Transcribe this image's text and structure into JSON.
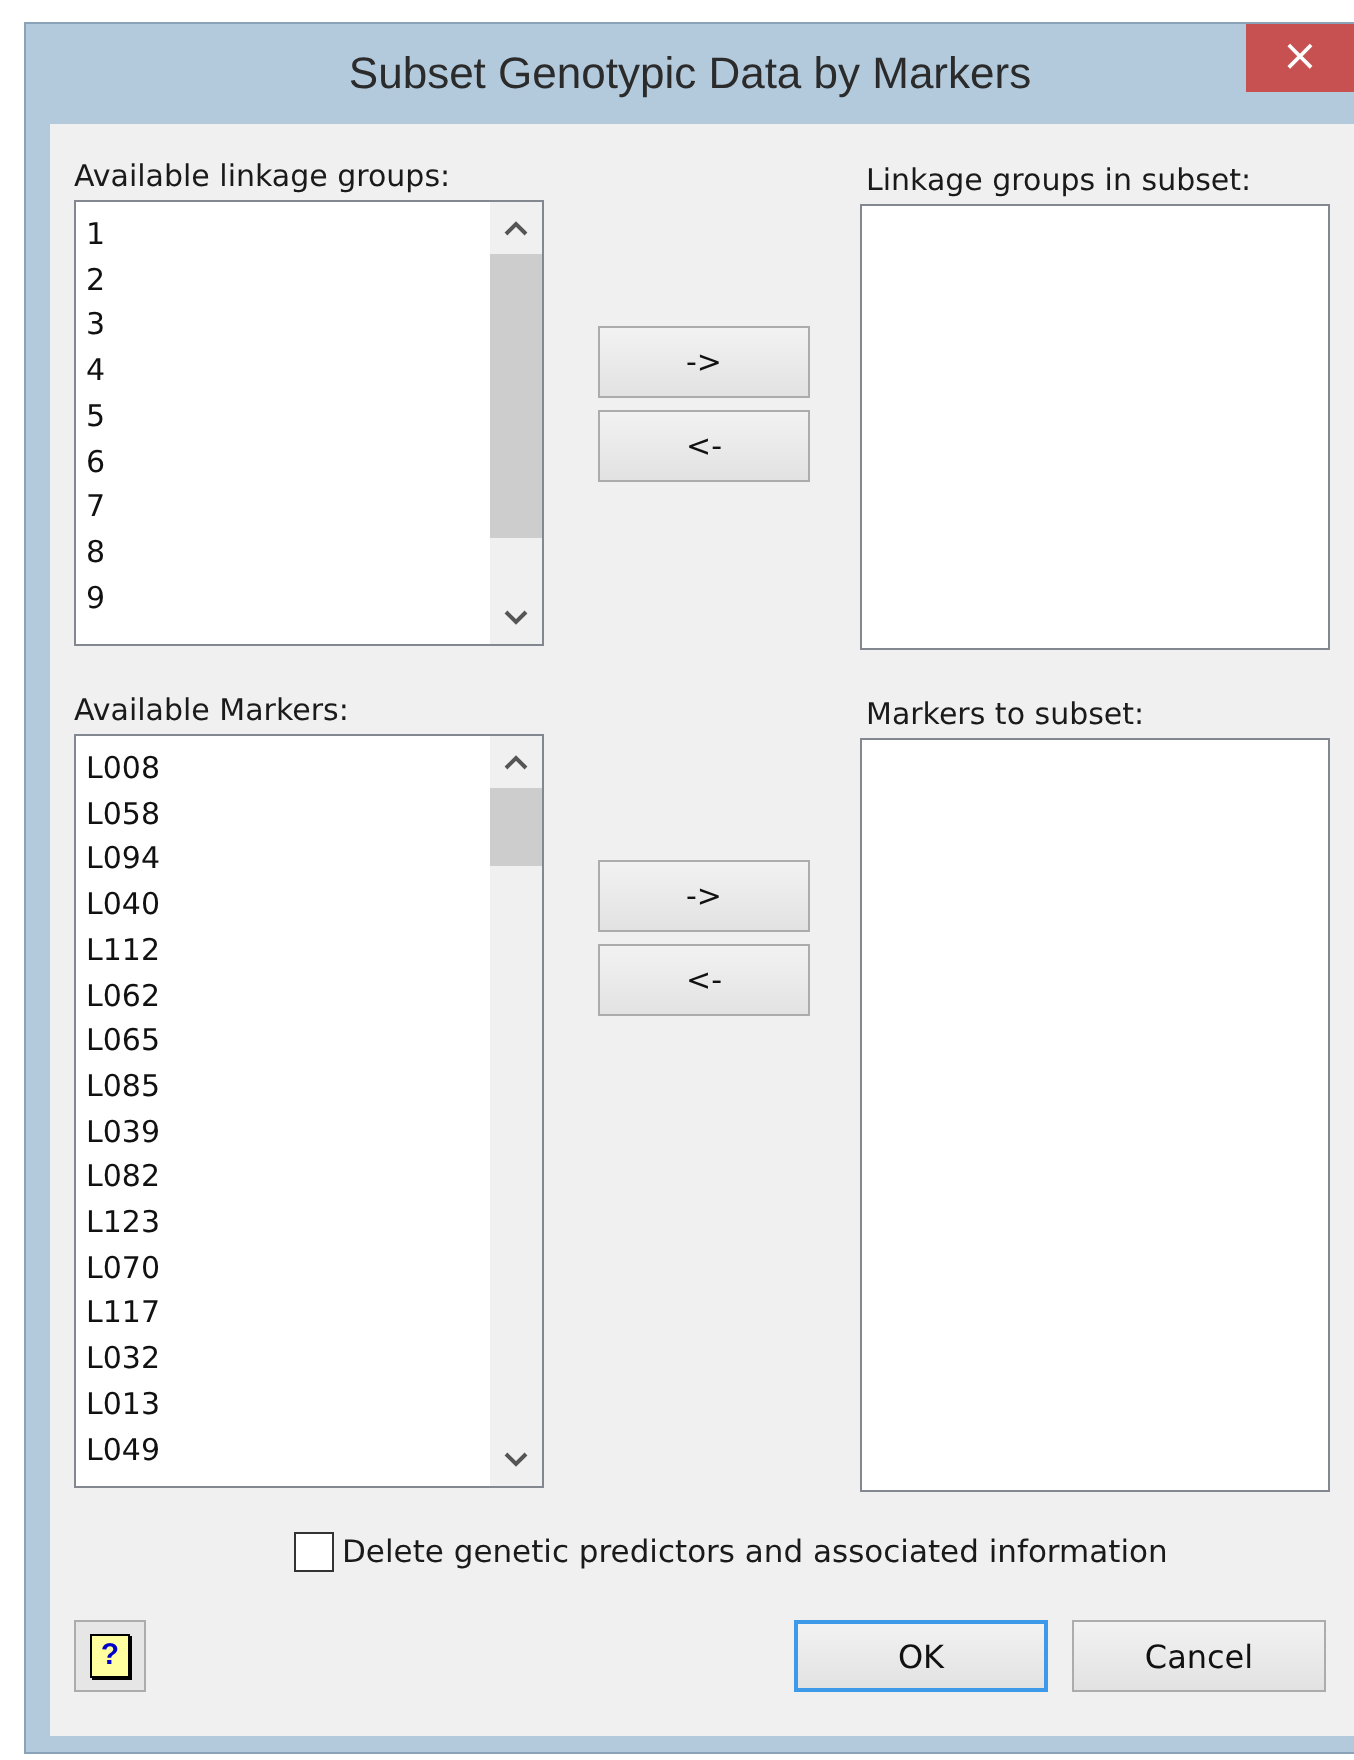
{
  "window": {
    "title": "Subset Genotypic Data by Markers",
    "close": "×"
  },
  "sections": [
    {
      "available_label": "Available linkage groups:",
      "available_items": [
        "1",
        "2",
        "3",
        "4",
        "5",
        "6",
        "7",
        "8",
        "9"
      ],
      "subset_label": "Linkage groups in subset:",
      "add_button": "->",
      "remove_button": "<-"
    },
    {
      "available_label": "Available Markers:",
      "available_items": [
        "L008",
        "L058",
        "L094",
        "L040",
        "L112",
        "L062",
        "L065",
        "L085",
        "L039",
        "L082",
        "L123",
        "L070",
        "L117",
        "L032",
        "L013",
        "L049"
      ],
      "subset_label": "Markers to subset:",
      "add_button": "->",
      "remove_button": "<-"
    }
  ],
  "delete_checkbox": {
    "label": "Delete genetic predictors and associated information",
    "checked": false
  },
  "help_button": "?",
  "buttons": [
    {
      "label": "OK",
      "default": true
    },
    {
      "label": "Cancel",
      "default": false
    }
  ]
}
